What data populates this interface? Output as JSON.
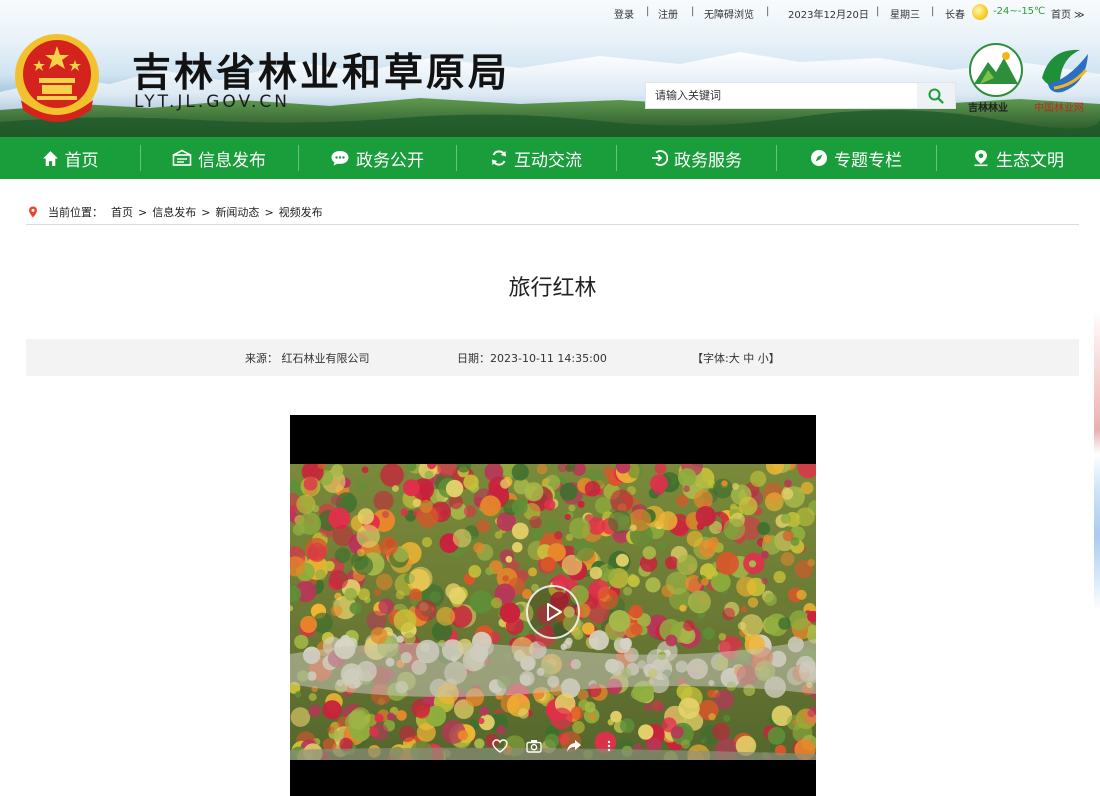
{
  "topbar": {
    "login": "登录",
    "register": "注册",
    "accessible": "无障碍浏览",
    "date": "2023年12月20日",
    "weekday": "星期三",
    "city": "长春",
    "temperature": "-24~-15℃",
    "home": "首页 ≫",
    "sep": "|"
  },
  "header": {
    "site_title": "吉林省林业和草原局",
    "site_domain": "LYT.JL.GOV.CN",
    "search_placeholder": "请输入关键词",
    "logo1_caption": "吉林林业",
    "logo2_caption": "中国林业网"
  },
  "nav": {
    "items": [
      {
        "label": "首页",
        "icon": "home-icon"
      },
      {
        "label": "信息发布",
        "icon": "info-icon"
      },
      {
        "label": "政务公开",
        "icon": "chat-icon"
      },
      {
        "label": "互动交流",
        "icon": "refresh-icon"
      },
      {
        "label": "政务服务",
        "icon": "login-icon"
      },
      {
        "label": "专题专栏",
        "icon": "compass-icon"
      },
      {
        "label": "生态文明",
        "icon": "pin-icon"
      }
    ]
  },
  "breadcrumb": {
    "label": "当前位置：",
    "items": [
      "首页",
      "信息发布",
      "新闻动态",
      "视频发布"
    ],
    "separator": ">"
  },
  "article": {
    "title": "旅行红林",
    "source": "来源：  红石林业有限公司",
    "date": "日期：2023-10-11 14:35:00",
    "font_open": "【字体:",
    "font_large": "大",
    "font_medium": "中",
    "font_small": "小",
    "font_close": "】"
  },
  "colors": {
    "nav_green": "#1a9e3b",
    "temperature": "#2c9b3a"
  }
}
